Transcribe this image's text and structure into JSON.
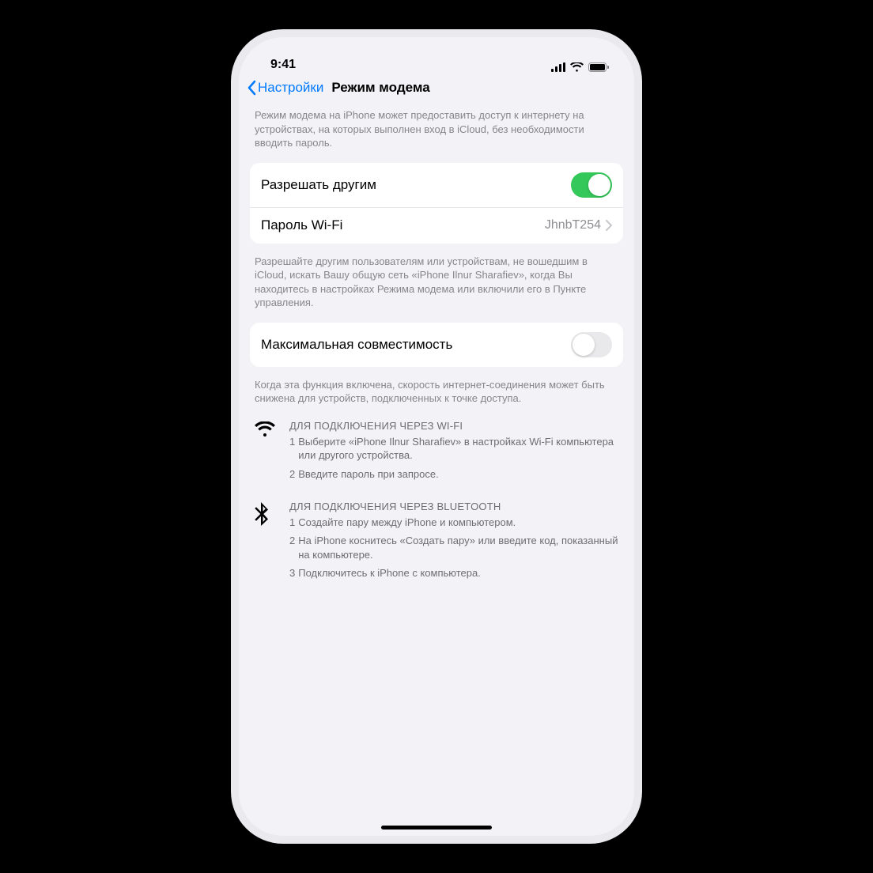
{
  "statusbar": {
    "time": "9:41"
  },
  "nav": {
    "back": "Настройки",
    "title": "Режим модема"
  },
  "intro": "Режим модема на iPhone может предоставить доступ к интернету на устройствах, на которых выполнен вход в iCloud, без необходимости вводить пароль.",
  "group1": {
    "allow_label": "Разрешать другим",
    "allow_on": true,
    "wifi_pw_label": "Пароль Wi-Fi",
    "wifi_pw_value": "JhnbT254"
  },
  "footer1": "Разрешайте другим пользователям или устройствам, не вошедшим в iCloud, искать Вашу общую сеть «iPhone Ilnur Sharafiev», когда Вы находитесь в настройках Режима модема или включили его в Пункте управления.",
  "group2": {
    "maxcompat_label": "Максимальная совместимость",
    "maxcompat_on": false
  },
  "footer2": "Когда эта функция включена, скорость интернет-соединения может быть снижена для устройств, подключенных к точке доступа.",
  "wifi_instructions": {
    "title": "ДЛЯ ПОДКЛЮЧЕНИЯ ЧЕРЕЗ WI-FI",
    "steps": [
      "Выберите «iPhone Ilnur Sharafiev» в настройках Wi-Fi компьютера или другого устройства.",
      "Введите пароль при запросе."
    ]
  },
  "bt_instructions": {
    "title": "ДЛЯ ПОДКЛЮЧЕНИЯ ЧЕРЕЗ BLUETOOTH",
    "steps": [
      "Создайте пару между iPhone и компьютером.",
      "На iPhone коснитесь «Создать пару» или введите код, показанный на компьютере.",
      "Подключитесь к iPhone с компьютера."
    ]
  }
}
